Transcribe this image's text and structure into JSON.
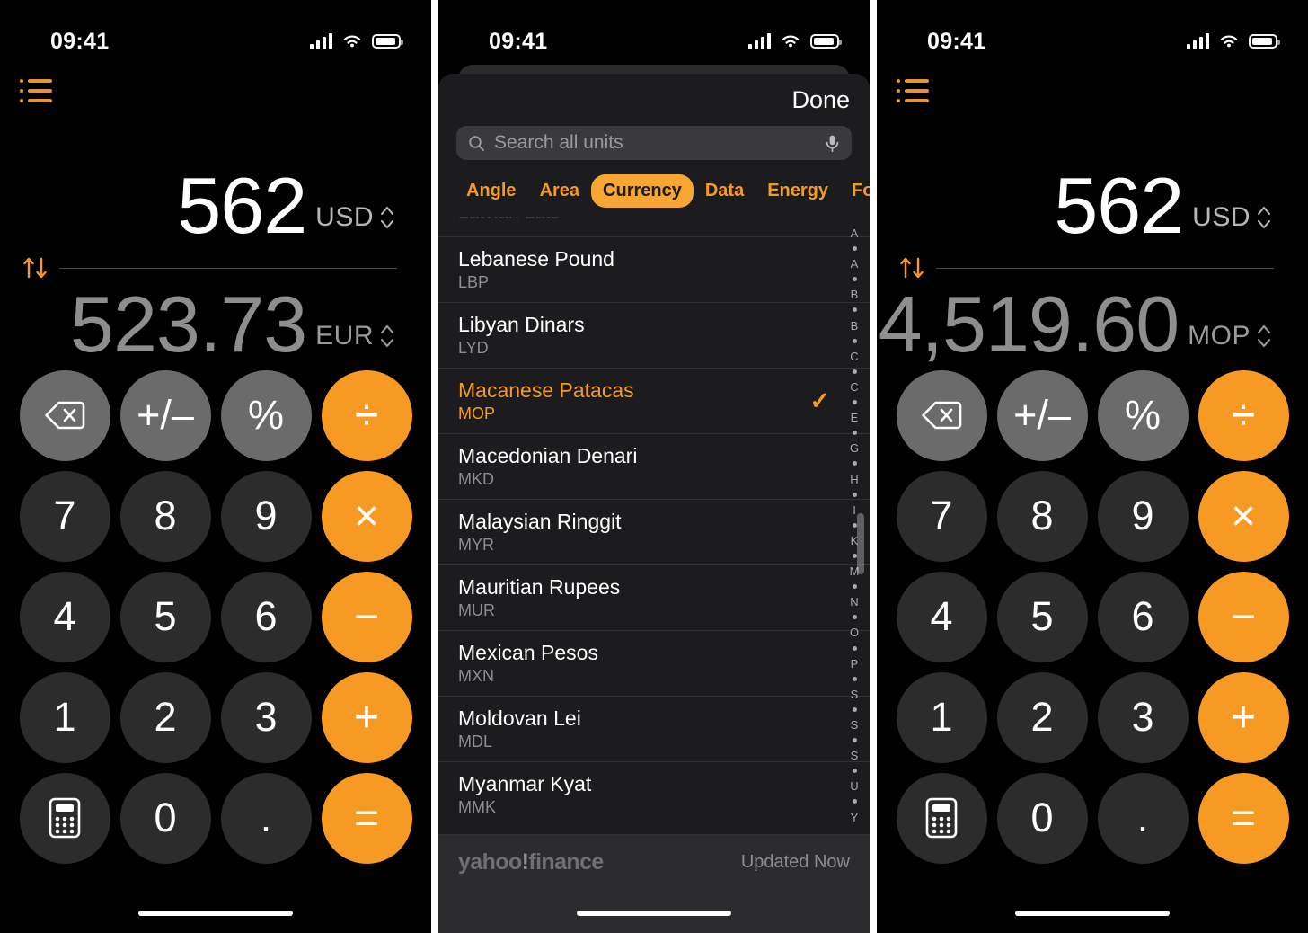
{
  "status_bar": {
    "time": "09:41",
    "signal_icon": "cellular-bars-icon",
    "wifi_icon": "wifi-icon",
    "battery_icon": "battery-icon"
  },
  "colors": {
    "accent_orange": "#F79A23",
    "tab_orange": "#F7A633",
    "icon_orange": "#E8913A",
    "key_func_gray": "#6b6b6b",
    "key_digit_gray": "#2c2c2c",
    "sheet_bg": "#1c1c1e",
    "secondary_text": "#8e8e8e"
  },
  "screens": [
    {
      "id": "converter-eur",
      "menu_icon": "bulleted-list-icon",
      "swap_icon": "swap-vertical-arrows-icon",
      "display": {
        "input_value": "562",
        "input_unit": "USD",
        "output_value": "523.73",
        "output_unit": "EUR"
      }
    },
    {
      "id": "unit-picker",
      "done_label": "Done",
      "search": {
        "placeholder": "Search all units",
        "search_icon": "search-icon",
        "mic_icon": "microphone-icon"
      },
      "categories": [
        {
          "label": "Angle",
          "active": false
        },
        {
          "label": "Area",
          "active": false
        },
        {
          "label": "Currency",
          "active": true
        },
        {
          "label": "Data",
          "active": false
        },
        {
          "label": "Energy",
          "active": false
        },
        {
          "label": "Force",
          "active": false
        }
      ],
      "units": [
        {
          "name": "Lebanese Pound",
          "code": "LBP",
          "selected": false
        },
        {
          "name": "Libyan Dinars",
          "code": "LYD",
          "selected": false
        },
        {
          "name": "Macanese Patacas",
          "code": "MOP",
          "selected": true
        },
        {
          "name": "Macedonian Denari",
          "code": "MKD",
          "selected": false
        },
        {
          "name": "Malaysian Ringgit",
          "code": "MYR",
          "selected": false
        },
        {
          "name": "Mauritian Rupees",
          "code": "MUR",
          "selected": false
        },
        {
          "name": "Mexican Pesos",
          "code": "MXN",
          "selected": false
        },
        {
          "name": "Moldovan Lei",
          "code": "MDL",
          "selected": false
        },
        {
          "name": "Myanmar Kyat",
          "code": "MMK",
          "selected": false
        }
      ],
      "section_index": [
        "A",
        "•",
        "A",
        "•",
        "B",
        "•",
        "B",
        "•",
        "C",
        "•",
        "C",
        "•",
        "E",
        "•",
        "G",
        "•",
        "H",
        "•",
        "I",
        "•",
        "K",
        "•",
        "M",
        "•",
        "N",
        "•",
        "O",
        "•",
        "P",
        "•",
        "S",
        "•",
        "S",
        "•",
        "S",
        "•",
        "U",
        "•",
        "Y"
      ],
      "footer": {
        "provider_1": "yahoo",
        "provider_2": "!",
        "provider_3": "finance",
        "updated": "Updated Now"
      },
      "selected_check_icon": "checkmark-icon"
    },
    {
      "id": "converter-mop",
      "menu_icon": "bulleted-list-icon",
      "swap_icon": "swap-vertical-arrows-icon",
      "display": {
        "input_value": "562",
        "input_unit": "USD",
        "output_value": "4,519.60",
        "output_unit": "MOP"
      }
    }
  ],
  "keypad": {
    "rows": [
      [
        {
          "label": "⌫",
          "type": "func",
          "name": "backspace-key",
          "icon": "backspace-icon"
        },
        {
          "label": "+/–",
          "type": "func",
          "name": "sign-toggle-key"
        },
        {
          "label": "%",
          "type": "func",
          "name": "percent-key"
        },
        {
          "label": "÷",
          "type": "op",
          "name": "divide-key"
        }
      ],
      [
        {
          "label": "7",
          "type": "digit",
          "name": "digit-7-key"
        },
        {
          "label": "8",
          "type": "digit",
          "name": "digit-8-key"
        },
        {
          "label": "9",
          "type": "digit",
          "name": "digit-9-key"
        },
        {
          "label": "×",
          "type": "op",
          "name": "multiply-key"
        }
      ],
      [
        {
          "label": "4",
          "type": "digit",
          "name": "digit-4-key"
        },
        {
          "label": "5",
          "type": "digit",
          "name": "digit-5-key"
        },
        {
          "label": "6",
          "type": "digit",
          "name": "digit-6-key"
        },
        {
          "label": "−",
          "type": "op",
          "name": "minus-key"
        }
      ],
      [
        {
          "label": "1",
          "type": "digit",
          "name": "digit-1-key"
        },
        {
          "label": "2",
          "type": "digit",
          "name": "digit-2-key"
        },
        {
          "label": "3",
          "type": "digit",
          "name": "digit-3-key"
        },
        {
          "label": "+",
          "type": "op",
          "name": "plus-key"
        }
      ],
      [
        {
          "label": "⌨",
          "type": "digit",
          "name": "calculator-mode-key",
          "icon": "calculator-icon"
        },
        {
          "label": "0",
          "type": "digit",
          "name": "digit-0-key"
        },
        {
          "label": ".",
          "type": "digit",
          "name": "decimal-point-key"
        },
        {
          "label": "=",
          "type": "op",
          "name": "equals-key"
        }
      ]
    ]
  }
}
